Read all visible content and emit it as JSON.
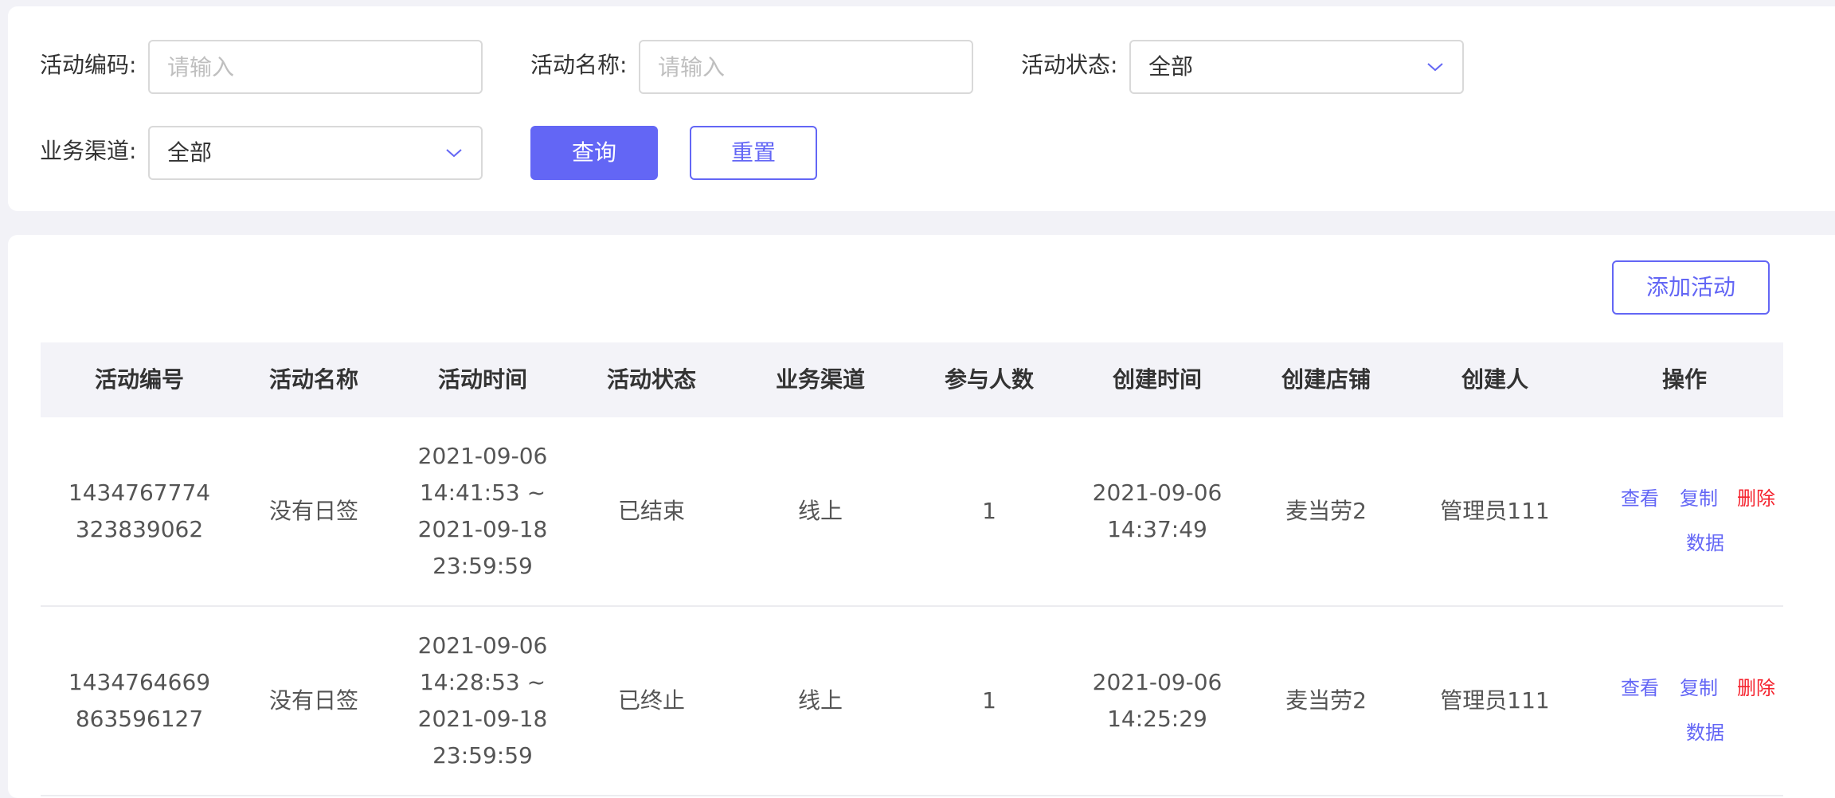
{
  "filters": {
    "code_label": "活动编码:",
    "code_placeholder": "请输入",
    "name_label": "活动名称:",
    "name_placeholder": "请输入",
    "status_label": "活动状态:",
    "status_value": "全部",
    "channel_label": "业务渠道:",
    "channel_value": "全部",
    "query_label": "查询",
    "reset_label": "重置"
  },
  "toolbar": {
    "add_label": "添加活动"
  },
  "table": {
    "columns": [
      "活动编号",
      "活动名称",
      "活动时间",
      "活动状态",
      "业务渠道",
      "参与人数",
      "创建时间",
      "创建店铺",
      "创建人",
      "操作"
    ],
    "rows": [
      {
        "id": "1434767774323839062",
        "name": "没有日签",
        "time": "2021-09-06 14:41:53 ~ 2021-09-18 23:59:59",
        "status": "已结束",
        "channel": "线上",
        "participants": "1",
        "created": "2021-09-06 14:37:49",
        "store": "麦当劳2",
        "creator": "管理员111"
      },
      {
        "id": "1434764669863596127",
        "name": "没有日签",
        "time": "2021-09-06 14:28:53 ~ 2021-09-18 23:59:59",
        "status": "已终止",
        "channel": "线上",
        "participants": "1",
        "created": "2021-09-06 14:25:29",
        "store": "麦当劳2",
        "creator": "管理员111"
      }
    ],
    "actions": {
      "view": "查看",
      "copy": "复制",
      "delete": "删除",
      "data": "数据"
    }
  },
  "colors": {
    "accent": "#6366f5",
    "danger": "#f5222d",
    "background": "#f2f2f7"
  },
  "icons": {
    "select_arrow": "chevron-down-icon"
  }
}
